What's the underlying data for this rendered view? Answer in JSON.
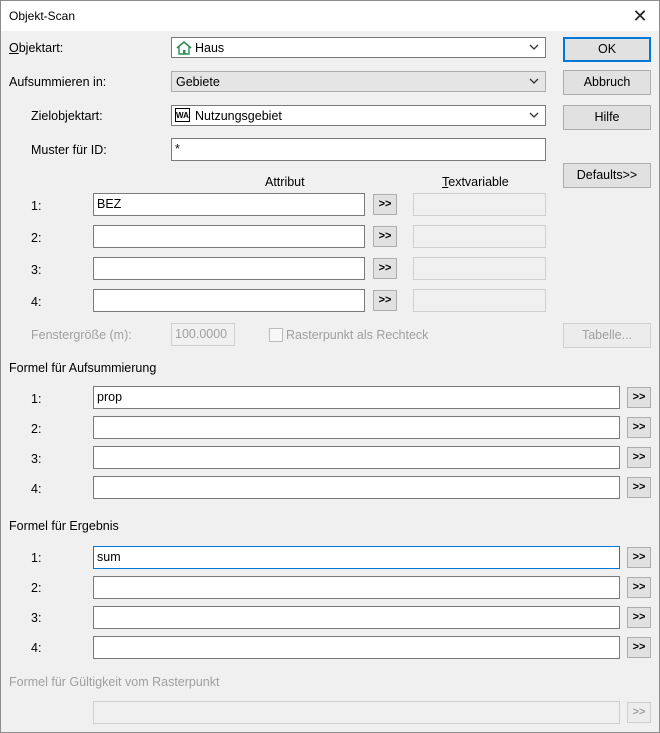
{
  "window": {
    "title": "Objekt-Scan"
  },
  "objektart": {
    "label": "Objektart:",
    "value": "Haus"
  },
  "aufsummieren": {
    "label": "Aufsummieren in:",
    "value": "Gebiete"
  },
  "zielobjektart": {
    "label": "Zielobjektart:",
    "value": "Nutzungsgebiet",
    "icon_text": "WA"
  },
  "muster": {
    "label": "Muster für ID:",
    "value": "*"
  },
  "attribut": {
    "header": "Attribut",
    "textvariable_header": "Textvariable",
    "rows": [
      {
        "label": "1:",
        "value": "BEZ"
      },
      {
        "label": "2:",
        "value": ""
      },
      {
        "label": "3:",
        "value": ""
      },
      {
        "label": "4:",
        "value": ""
      }
    ]
  },
  "fenstergroesse": {
    "label": "Fenstergröße (m):",
    "value": "100.0000"
  },
  "rasterpunkt": {
    "label": "Rasterpunkt als Rechteck"
  },
  "formel_aufsummierung": {
    "header": "Formel für Aufsummierung",
    "rows": [
      {
        "label": "1:",
        "value": "prop"
      },
      {
        "label": "2:",
        "value": ""
      },
      {
        "label": "3:",
        "value": ""
      },
      {
        "label": "4:",
        "value": ""
      }
    ]
  },
  "formel_ergebnis": {
    "header": "Formel für Ergebnis",
    "rows": [
      {
        "label": "1:",
        "value": "sum"
      },
      {
        "label": "2:",
        "value": ""
      },
      {
        "label": "3:",
        "value": ""
      },
      {
        "label": "4:",
        "value": ""
      }
    ]
  },
  "formel_gueltigkeit": {
    "header": "Formel für Gültigkeit vom Rasterpunkt",
    "value": ""
  },
  "buttons": {
    "ok": "OK",
    "abbruch": "Abbruch",
    "hilfe": "Hilfe",
    "defaults": "Defaults>>",
    "tabelle": "Tabelle...",
    "more": ">>"
  },
  "icons": {
    "close": "close-icon",
    "house": "house-icon",
    "chevron": "chevron-down-icon"
  },
  "colors": {
    "accent": "#0078d7",
    "dialog_bg": "#f0f0f0",
    "house_green": "#2e8b57"
  }
}
